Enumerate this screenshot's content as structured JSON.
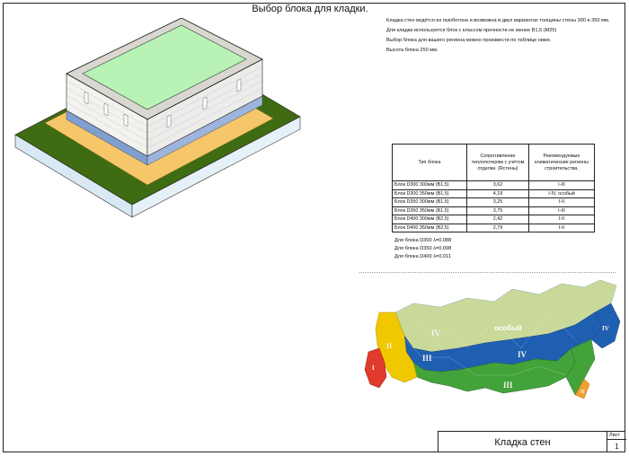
{
  "title": "Выбор блока для кладки.",
  "notes": [
    "Кладка стен ведётся из газобетона  и возможна в двух  вариантах толщины стены  300 и 350 мм.",
    "Для кладки используется блок с классом прочности не  менее В1,5 (М25)",
    "Выбор блока для вашего региона можно произвести по таблице ниже.",
    "Высота блока 250 мм."
  ],
  "table": {
    "headers": {
      "type": "Тип блока",
      "resistance": "Сопротивление теплопотерям с учётом отделки. (Rстены)",
      "regions": "Рекомендуемые климатические регионы строительства."
    },
    "rows": [
      {
        "type": "Блок D300 300мм (В1,5)",
        "resistance": "3,62",
        "regions": "I-III"
      },
      {
        "type": "Блок D300 350мм (В1,5)",
        "resistance": "4,19",
        "regions": "I-IV, особый"
      },
      {
        "type": "Блок D350 300мм (В1,5)",
        "resistance": "3,25",
        "regions": "I-II"
      },
      {
        "type": "Блок D350 350мм (В1,5)",
        "resistance": "3,75",
        "regions": "I-III"
      },
      {
        "type": "Блок D400 300мм (В2,5)",
        "resistance": "2,42",
        "regions": "I-II"
      },
      {
        "type": "Блок D400 350мм (В2,5)",
        "resistance": "2,79",
        "regions": "I-II"
      }
    ]
  },
  "lambda_lines": [
    "Для блока D300 λ=0,088",
    "Для блока D350 λ=0,098",
    "Для блока D400 λ=0,011"
  ],
  "map_labels": {
    "zone_special": "особый",
    "zone_4_west": "IV",
    "zone_4_center": "IV",
    "zone_4_east": "IV",
    "zone_3_west": "III",
    "zone_3_center": "III",
    "zone_2": "II",
    "zone_1": "I",
    "zone_2_east": "II"
  },
  "stamp": {
    "name": "Кладка стен",
    "sheet_label": "Лист",
    "sheet_number": "1"
  },
  "colors": {
    "ground": "#3f6b12",
    "base": "#d9e9f3",
    "roof_slab": "#b8f2b4",
    "sand": "#f5c66a",
    "zone_special": "#c8d99a",
    "zone_4": "#1f5fb2",
    "zone_3": "#42a33a",
    "zone_2": "#f0c800",
    "zone_1": "#e03b2c"
  }
}
